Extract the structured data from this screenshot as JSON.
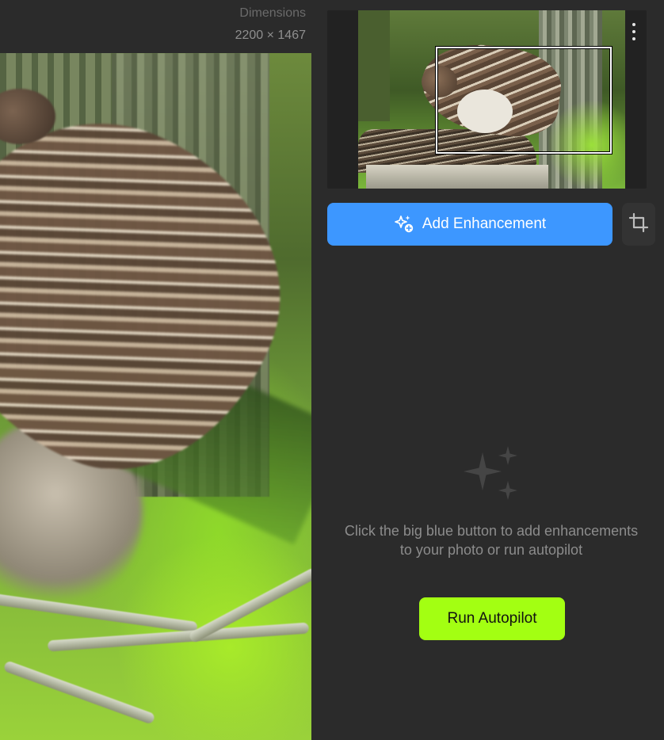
{
  "canvas": {
    "dimensions_label": "Dimensions",
    "dimensions_value": "2200 × 1467"
  },
  "sidebar": {
    "menu_icon": "more-vertical-icon",
    "add_enhancement": {
      "label": "Add Enhancement",
      "icon": "sparkle-plus-icon",
      "color": "#3d97ff"
    },
    "crop": {
      "icon": "crop-icon"
    },
    "empty_state": {
      "icon": "sparkles-icon",
      "message": "Click the big blue button to add enhancements to your photo or run autopilot"
    },
    "run_autopilot": {
      "label": "Run Autopilot",
      "color": "#a3ff12"
    }
  }
}
